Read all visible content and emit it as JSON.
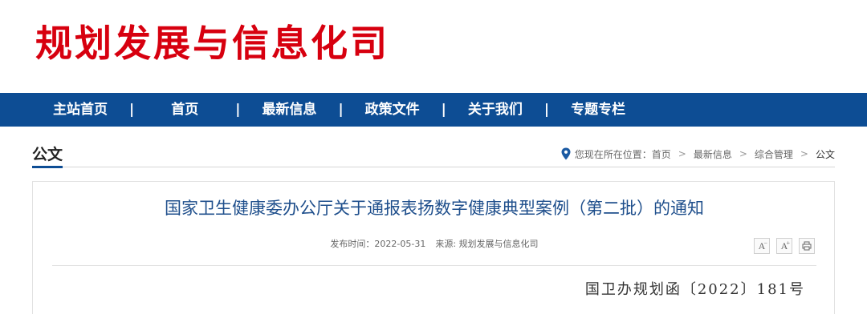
{
  "header": {
    "site_title": "规划发展与信息化司",
    "brand_color": "#d7000f",
    "nav_color": "#0d4d94"
  },
  "nav": {
    "items": [
      {
        "label": "主站首页"
      },
      {
        "label": "首页"
      },
      {
        "label": "最新信息"
      },
      {
        "label": "政策文件"
      },
      {
        "label": "关于我们"
      },
      {
        "label": "专题专栏"
      }
    ],
    "separator": "|"
  },
  "section": {
    "title": "公文"
  },
  "breadcrumb": {
    "icon": "location-pin-icon",
    "prefix": "您现在所在位置：",
    "items": [
      "首页",
      "最新信息",
      "综合管理",
      "公文"
    ],
    "separator": ">"
  },
  "article": {
    "title": "国家卫生健康委办公厅关于通报表扬数字健康典型案例（第二批）的通知",
    "publish_label": "发布时间：",
    "publish_date": "2022-05-31",
    "source_label": "来源: ",
    "source": "规划发展与信息化司",
    "tools": {
      "decrease_font": "A",
      "increase_font": "A",
      "print_icon": "print-icon"
    },
    "doc_number": "国卫办规划函〔2022〕181号"
  }
}
